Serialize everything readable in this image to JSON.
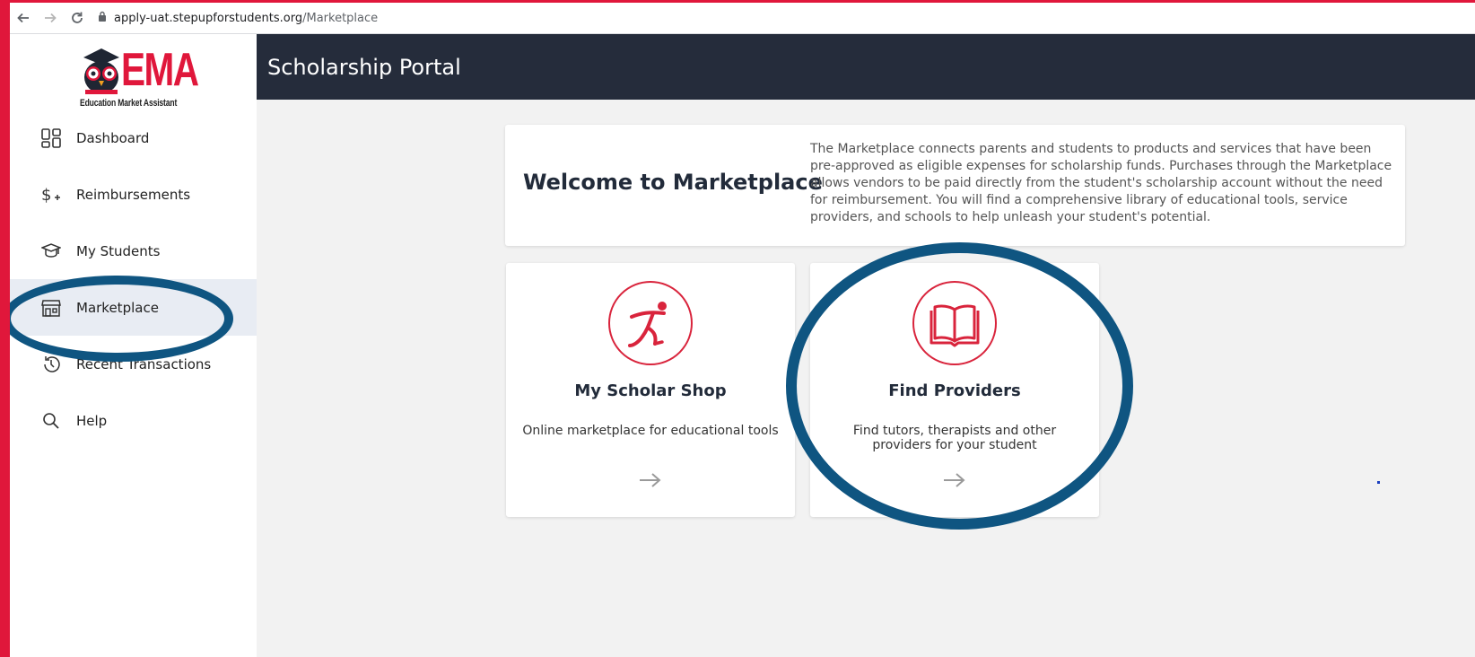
{
  "browser": {
    "url_domain": "apply-uat.stepupforstudents.org",
    "url_path": "/Marketplace",
    "icons": [
      "back-icon",
      "forward-icon",
      "reload-icon",
      "lock-icon"
    ]
  },
  "logo": {
    "wordmark": "EMA",
    "subtitle": "Education Market Assistant"
  },
  "sidebar": {
    "items": [
      {
        "label": "Dashboard",
        "icon": "dashboard-icon"
      },
      {
        "label": "Reimbursements",
        "icon": "dollar-plus-icon"
      },
      {
        "label": "My Students",
        "icon": "graduation-cap-icon"
      },
      {
        "label": "Marketplace",
        "icon": "storefront-icon",
        "active": true
      },
      {
        "label": "Recent Transactions",
        "icon": "history-icon"
      },
      {
        "label": "Help",
        "icon": "search-icon"
      }
    ]
  },
  "header": {
    "title": "Scholarship Portal"
  },
  "welcome": {
    "title": "Welcome to Marketplace",
    "description": "The Marketplace connects parents and students to products and services that have been pre-approved as eligible expenses for scholarship funds. Purchases through the Marketplace allows vendors to be paid directly from the student's scholarship account without the need for reimbursement. You will find a comprehensive library of educational tools, service providers, and schools to help unleash your student's potential."
  },
  "tiles": [
    {
      "title": "My Scholar Shop",
      "description": "Online marketplace for educational tools",
      "icon": "running-figure-icon"
    },
    {
      "title": "Find Providers",
      "description": "Find tutors, therapists and other providers for your student",
      "icon": "open-book-icon"
    }
  ],
  "colors": {
    "brand_red": "#e0173b",
    "header_bg": "#252c3b",
    "highlight_ring": "#0f5581",
    "active_nav_bg": "#e8ecf3"
  }
}
